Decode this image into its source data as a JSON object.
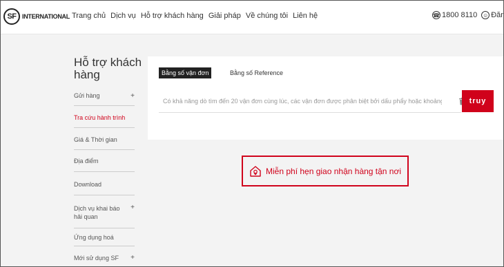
{
  "logo": {
    "mark": "SF",
    "text": "INTERNATIONAL"
  },
  "nav": [
    "Trang chủ",
    "Dịch vụ",
    "Hỗ trợ khách hàng",
    "Giải pháp",
    "Về chúng tôi",
    "Liên hệ"
  ],
  "header_right": {
    "phone": "1800 8110",
    "login": "Đăng"
  },
  "sidebar": {
    "title": "Hỗ trợ khách hàng",
    "items": [
      {
        "label": "Gửi hàng",
        "plus": "+"
      },
      {
        "label": "Tra cứu hành trình",
        "plus": ""
      },
      {
        "label": "Giá & Thời gian",
        "plus": ""
      },
      {
        "label": "Địa điểm",
        "plus": ""
      },
      {
        "label": "Download",
        "plus": ""
      },
      {
        "label": "Dịch vụ khai báo hải quan",
        "plus": "+"
      },
      {
        "label": "Ứng dụng hoá",
        "plus": ""
      },
      {
        "label": "Mới sử dụng SF",
        "plus": "+"
      }
    ]
  },
  "tabs": {
    "active": "Bằng số vận đơn",
    "other": "Bằng số Reference"
  },
  "search": {
    "placeholder": "Có khả năng dò tìm đến 20 vận đơn cùng lúc, các vận đơn được phân biệt bởi dấu phẩy hoặc khoảng trắng",
    "button": "truy"
  },
  "promo": {
    "text": "Miễn phí hẹn giao nhận hàng tận nơi"
  },
  "colors": {
    "accent": "#d0021b",
    "tab_active_bg": "#222222"
  }
}
